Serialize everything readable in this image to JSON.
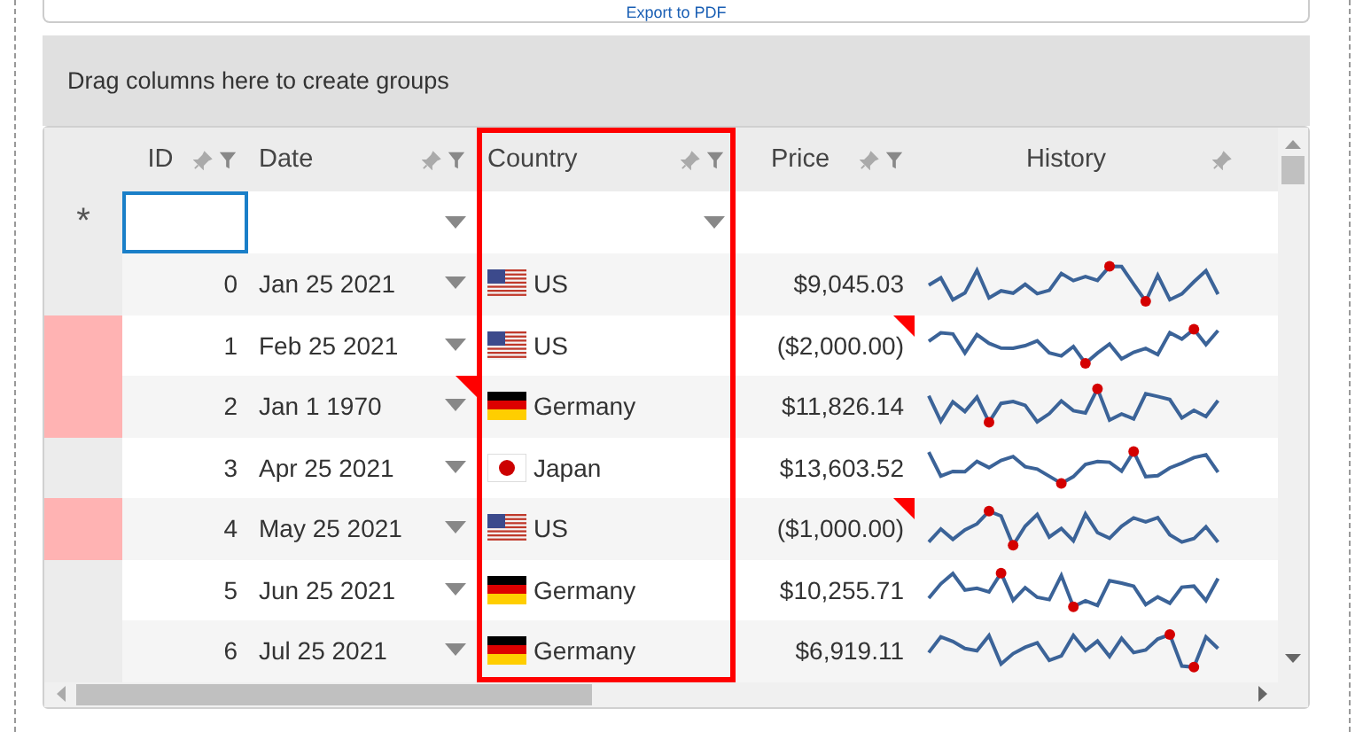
{
  "toolbar": {
    "button": "Export to PDF"
  },
  "group_panel": {
    "text": "Drag columns here to create groups"
  },
  "columns": [
    {
      "label": "ID",
      "kind": "number",
      "pin": true,
      "filter": true,
      "highlighted": false
    },
    {
      "label": "Date",
      "kind": "date",
      "pin": true,
      "filter": true,
      "highlighted": false
    },
    {
      "label": "Country",
      "kind": "country",
      "pin": true,
      "filter": true,
      "highlighted": true
    },
    {
      "label": "Price",
      "kind": "currency",
      "pin": true,
      "filter": true,
      "highlighted": false
    },
    {
      "label": "History",
      "kind": "sparkline",
      "pin": true,
      "filter": false,
      "highlighted": false
    }
  ],
  "new_row": {
    "marker": "*"
  },
  "rows": [
    {
      "id": "0",
      "date": "Jan 25 2021",
      "country": "US",
      "flag": {
        "kind": "us"
      },
      "price": "$9,045.03",
      "row_error": false,
      "date_error": false,
      "price_error": false
    },
    {
      "id": "1",
      "date": "Feb 25 2021",
      "country": "US",
      "flag": {
        "kind": "us"
      },
      "price": "($2,000.00)",
      "row_error": true,
      "date_error": false,
      "price_error": true
    },
    {
      "id": "2",
      "date": "Jan 1 1970",
      "country": "Germany",
      "flag": {
        "kind": "de"
      },
      "price": "$11,826.14",
      "row_error": true,
      "date_error": true,
      "price_error": false
    },
    {
      "id": "3",
      "date": "Apr 25 2021",
      "country": "Japan",
      "flag": {
        "kind": "jp"
      },
      "price": "$13,603.52",
      "row_error": false,
      "date_error": false,
      "price_error": false
    },
    {
      "id": "4",
      "date": "May 25 2021",
      "country": "US",
      "flag": {
        "kind": "us"
      },
      "price": "($1,000.00)",
      "row_error": true,
      "date_error": false,
      "price_error": true
    },
    {
      "id": "5",
      "date": "Jun 25 2021",
      "country": "Germany",
      "flag": {
        "kind": "de"
      },
      "price": "$10,255.71",
      "row_error": false,
      "date_error": false,
      "price_error": false
    },
    {
      "id": "6",
      "date": "Jul 25 2021",
      "country": "Germany",
      "flag": {
        "kind": "de"
      },
      "price": "$6,919.11",
      "row_error": false,
      "date_error": false,
      "price_error": false
    }
  ]
}
